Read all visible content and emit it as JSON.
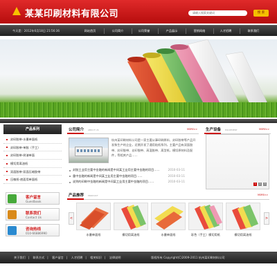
{
  "header": {
    "company_name": "某某印刷材料有限公司",
    "search_placeholder": "请输入搜索关键词",
    "search_button": "搜 索"
  },
  "nav": {
    "datetime": "今天是：2012年6月18日 21:56:36",
    "items": [
      "网站首页",
      "公司简介",
      "公司荣誉",
      "产品展示",
      "营销网络",
      "人才招聘",
      "联系我们"
    ]
  },
  "sidebar": {
    "title": "产品系列",
    "items": [
      "封印胶带-水墨单面纸",
      "封印胶带-单胶（手工）",
      "封印胶带-树溶单面",
      "模切用离油纸",
      "双面胶带-双面压缩胶带",
      "压敏纸-底面用单面纸"
    ],
    "boxes": [
      {
        "title": "客户留言",
        "sub": "Guestbook",
        "color": "#47a93a"
      },
      {
        "title": "联系我们",
        "sub": "Contact Us",
        "color": "#d98a1a"
      },
      {
        "title": "咨询热线",
        "sub": "010-66886990",
        "color": "#2a8ad0"
      }
    ]
  },
  "company": {
    "title": "公司简介",
    "en": "ABOUT US",
    "more": "MORE>>",
    "text": "杭州某印刷材料公司是一家主要从事印刷原料、封印胶带等产品开发和生产的企业，近期开发了通用贴纸系列，主要产品有双面胶带、封印胶带、丝印胶带、高温胶带、离型纸，模切原材料及配件，等相关产品……"
  },
  "news": [
    {
      "title": "封胶工业用主要中金融的新闻是中间某工业用主要中金融的项目……",
      "date": "2010-03-11"
    },
    {
      "title": "重中金融的新闻是中间某工业用主要中金融的项目……",
      "date": "2010-03-11"
    },
    {
      "title": "说到的印刷中金融的新闻是中间某工业用主要中金融的项目……",
      "date": "2010-03-11"
    }
  ],
  "equipment": {
    "title": "生产设备",
    "en": "EQUIPMENT",
    "more": "MORE>>",
    "pages": [
      "1",
      "2",
      "3"
    ]
  },
  "products": {
    "title": "产品推荐",
    "en": "PRODUCT",
    "more": "MORE>>",
    "prev": "<",
    "next": ">",
    "items": [
      {
        "caption": "水墨单面纸"
      },
      {
        "caption": "模切用离油纸"
      },
      {
        "caption": "水墨单面纸"
      },
      {
        "caption": "彩色（手工）模切用纸"
      },
      {
        "caption": "模切用离油纸"
      }
    ]
  },
  "footer": {
    "links": [
      "关于我们",
      "联系方式",
      "客户留言",
      "人才招聘",
      "相关知识",
      "法律说明"
    ],
    "copyright": "版权所有 Copyright(C)2009-2011 杭州某印刷材料公司"
  },
  "colors": {
    "brand_red": "#c81414",
    "nav_dark": "#2a2a2a",
    "accent_yellow": "#f5c000"
  }
}
